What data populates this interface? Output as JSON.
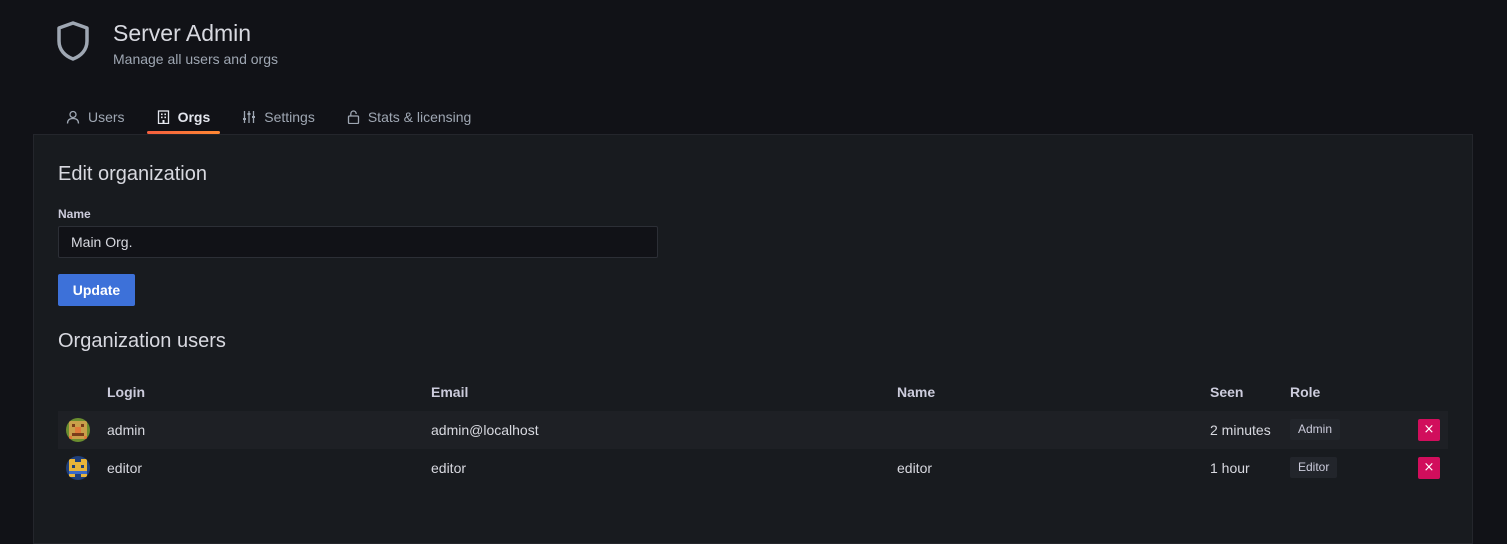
{
  "header": {
    "title": "Server Admin",
    "subtitle": "Manage all users and orgs",
    "icon": "shield-icon"
  },
  "tabs": [
    {
      "label": "Users",
      "icon": "user-icon",
      "active": false
    },
    {
      "label": "Orgs",
      "icon": "building-icon",
      "active": true
    },
    {
      "label": "Settings",
      "icon": "sliders-icon",
      "active": false
    },
    {
      "label": "Stats & licensing",
      "icon": "lock-icon",
      "active": false
    }
  ],
  "edit": {
    "title": "Edit organization",
    "name_label": "Name",
    "name_value": "Main Org.",
    "update_label": "Update"
  },
  "users": {
    "title": "Organization users",
    "columns": {
      "login": "Login",
      "email": "Email",
      "name": "Name",
      "seen": "Seen",
      "role": "Role"
    },
    "rows": [
      {
        "login": "admin",
        "email": "admin@localhost",
        "name": "",
        "seen": "2 minutes",
        "role": "Admin",
        "remove": "×"
      },
      {
        "login": "editor",
        "email": "editor",
        "name": "editor",
        "seen": "1 hour",
        "role": "Editor",
        "remove": "×"
      }
    ]
  },
  "colors": {
    "accent": "#f55f3e",
    "primary_button": "#3d71d9",
    "danger_button": "#d10e5c",
    "background": "#111217",
    "panel": "#181b1f"
  }
}
